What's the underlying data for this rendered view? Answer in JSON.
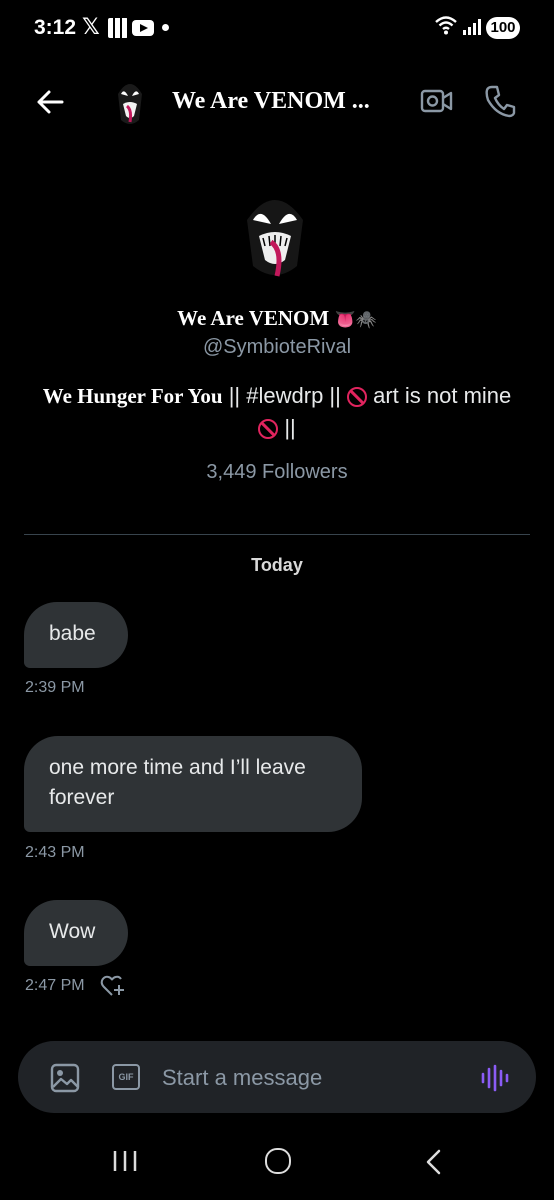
{
  "status_bar": {
    "time": "3:12",
    "battery": "100"
  },
  "header": {
    "title": "We Are VENOM ..."
  },
  "profile": {
    "name": "We Are VENOM",
    "name_emojis": "👅🕷️",
    "handle": "@SymbioteRival",
    "bio_bold": "We Hunger For You",
    "bio_part1": " || #lewdrp || ",
    "bio_part2": " art is not mine ",
    "bio_part3": " ||",
    "followers": "3,449 Followers"
  },
  "day_divider": "Today",
  "messages": [
    {
      "text": "babe",
      "time": "2:39 PM"
    },
    {
      "text": "one more time and I’ll leave forever",
      "time": "2:43 PM"
    },
    {
      "text": "Wow",
      "time": "2:47 PM"
    }
  ],
  "composer": {
    "placeholder": "Start a message",
    "gif_label": "GIF"
  },
  "colors": {
    "background": "#000000",
    "bubble": "#2f3336",
    "muted_text": "#8b98a5",
    "voice_accent": "#8b5cf6",
    "no_symbol": "#e0245e"
  }
}
